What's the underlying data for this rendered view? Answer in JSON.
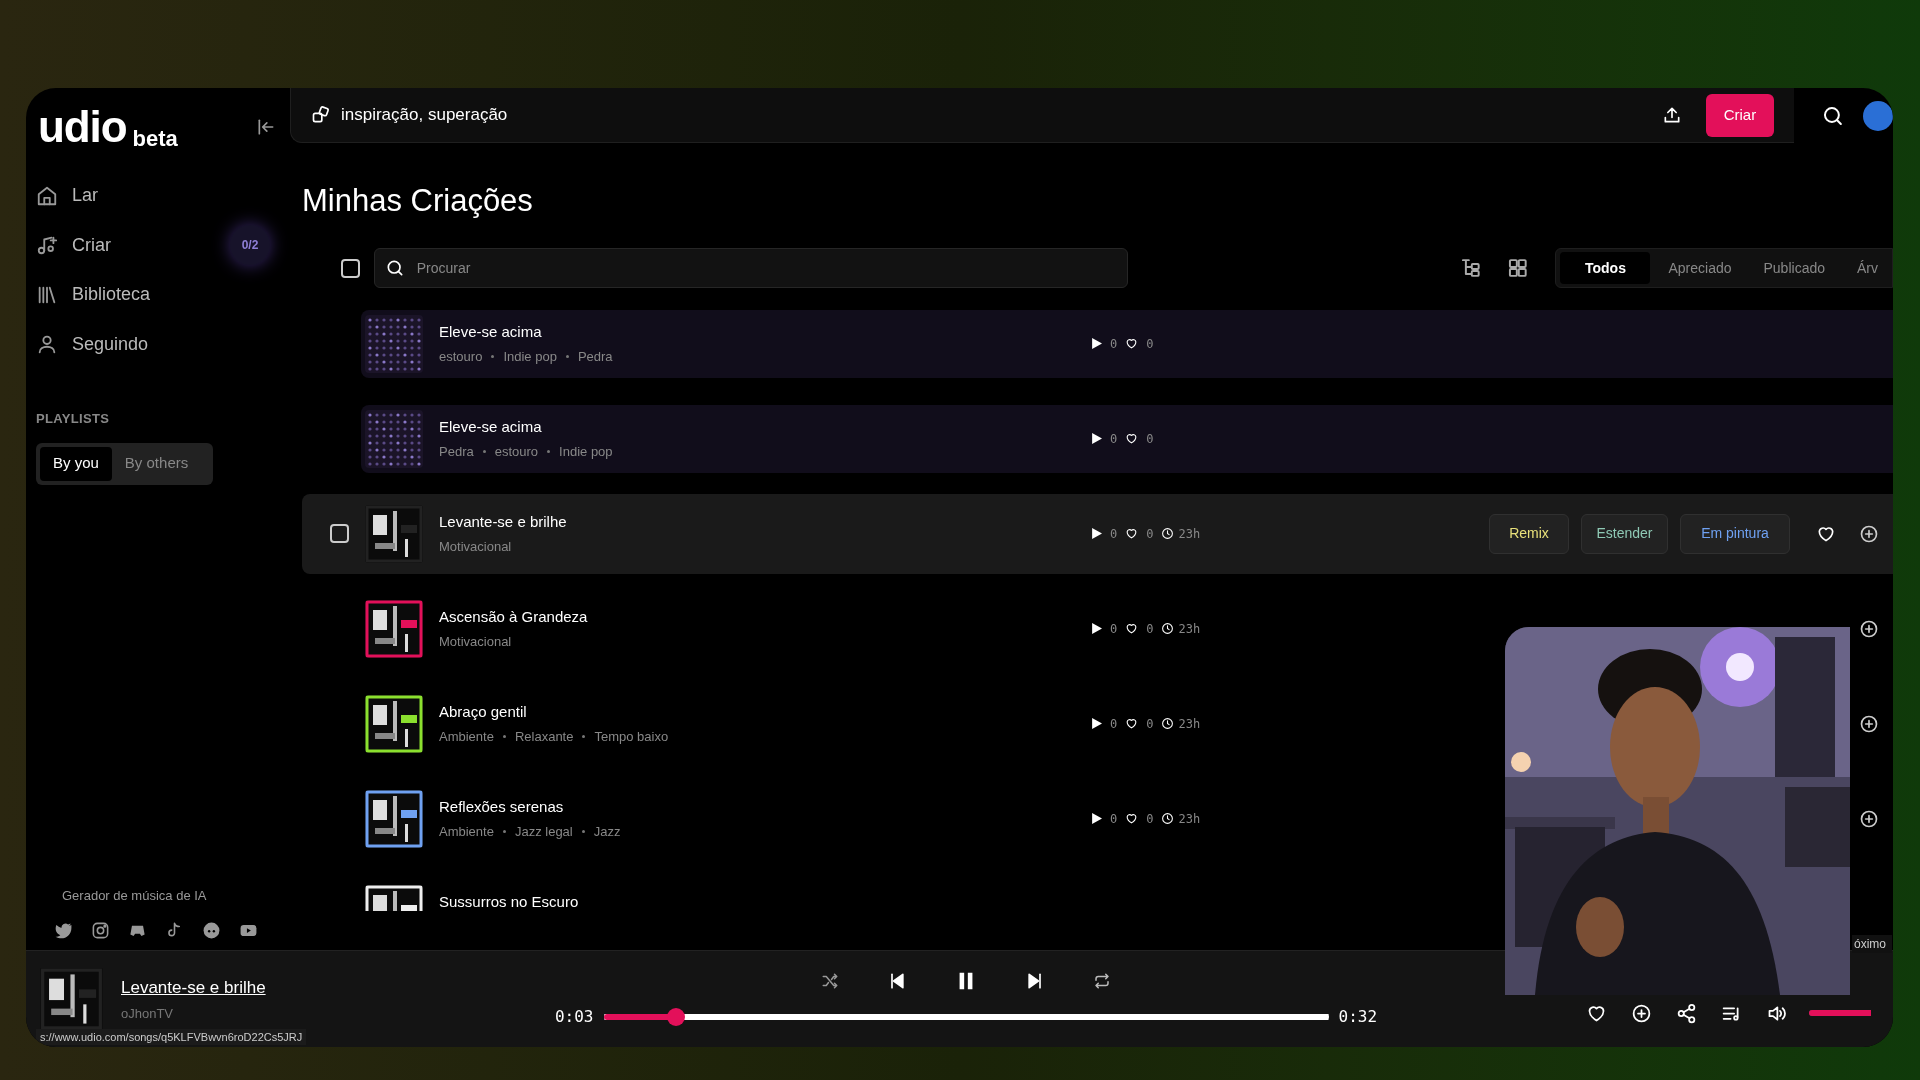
{
  "logo": {
    "name": "udio",
    "tag": "beta"
  },
  "prompt": {
    "value": "inspiração, superação"
  },
  "create_button": "Criar",
  "nav": [
    {
      "label": "Lar"
    },
    {
      "label": "Criar",
      "badge": "0/2"
    },
    {
      "label": "Biblioteca"
    },
    {
      "label": "Seguindo"
    }
  ],
  "playlists": {
    "heading": "PLAYLISTS",
    "tabs": [
      {
        "label": "By you",
        "selected": true
      },
      {
        "label": "By others",
        "selected": false
      }
    ]
  },
  "footer": {
    "tagline": "Gerador de música de IA"
  },
  "page": {
    "title": "Minhas Criações",
    "select_all": {
      "checked": false
    },
    "search": {
      "placeholder": "Procurar"
    },
    "filters": [
      {
        "label": "Todos",
        "selected": true
      },
      {
        "label": "Apreciado",
        "selected": false
      },
      {
        "label": "Publicado",
        "selected": false
      },
      {
        "label": "Árv",
        "selected": false
      }
    ]
  },
  "songs": [
    {
      "kind": "pending",
      "title": "Eleve-se acima",
      "tags": [
        "estouro",
        "Indie pop",
        "Pedra"
      ],
      "plays": "0",
      "likes": "0",
      "selected": false
    },
    {
      "kind": "pending",
      "title": "Eleve-se acima",
      "tags": [
        "Pedra",
        "estouro",
        "Indie pop"
      ],
      "plays": "0",
      "likes": "0",
      "selected": false
    },
    {
      "kind": "done",
      "title": "Levante-se e brilhe",
      "tags": [
        "Motivacional"
      ],
      "plays": "0",
      "likes": "0",
      "age": "23h",
      "selected": true,
      "checked": false,
      "actions": [
        "Remix",
        "Estender",
        "Em pintura"
      ]
    },
    {
      "kind": "done",
      "title": "Ascensão à Grandeza",
      "tags": [
        "Motivacional"
      ],
      "plays": "0",
      "likes": "0",
      "age": "23h",
      "selected": false
    },
    {
      "kind": "done",
      "title": "Abraço gentil",
      "tags": [
        "Ambiente",
        "Relaxante",
        "Tempo baixo"
      ],
      "plays": "0",
      "likes": "0",
      "age": "23h",
      "selected": false
    },
    {
      "kind": "done",
      "title": "Reflexões serenas",
      "tags": [
        "Ambiente",
        "Jazz legal",
        "Jazz"
      ],
      "plays": "0",
      "likes": "0",
      "age": "23h",
      "selected": false
    },
    {
      "kind": "partial",
      "title": "Sussurros no Escuro",
      "selected": false
    }
  ],
  "player": {
    "title": "Levante-se e brilhe",
    "artist": "oJhonTV",
    "playing": true,
    "elapsed": "0:03",
    "duration": "0:32",
    "level": 0.1,
    "volume": {
      "level": 1
    }
  },
  "tooltip": "óximo",
  "status_url": "s://www.udio.com/songs/q5KLFVBwvn6roD22Cs5JRJ"
}
